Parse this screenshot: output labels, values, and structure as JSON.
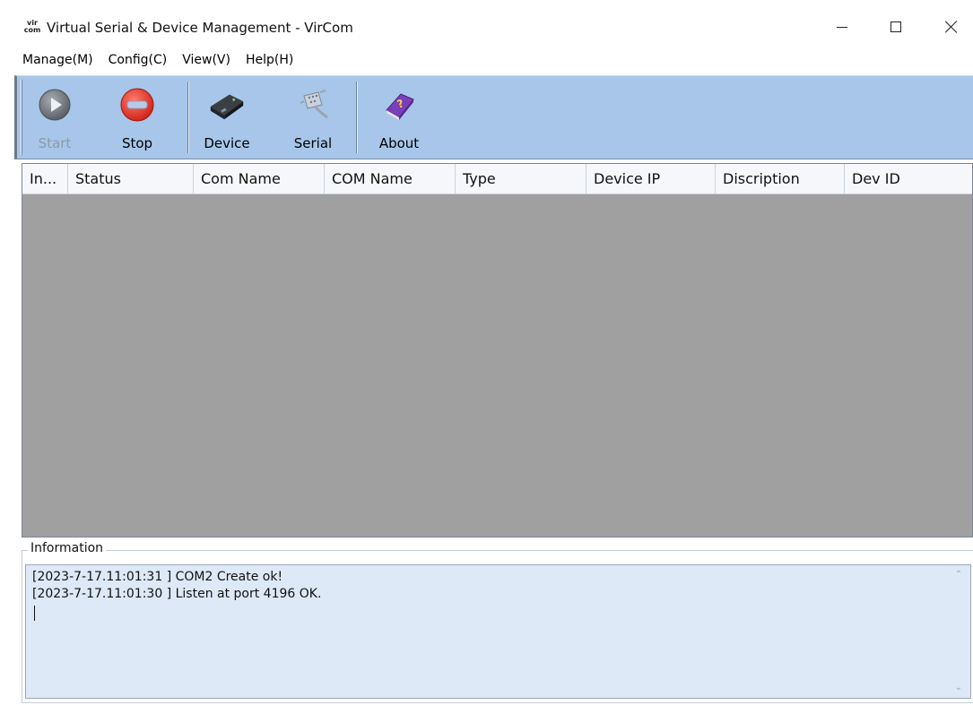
{
  "window": {
    "icon_text_top": "vir",
    "icon_text_bottom": "com",
    "title": "Virtual Serial & Device Management - VirCom"
  },
  "menu": [
    "Manage(M)",
    "Config(C)",
    "View(V)",
    "Help(H)"
  ],
  "toolbar": {
    "start_label": "Start",
    "start_enabled": false,
    "stop_label": "Stop",
    "device_label": "Device",
    "serial_label": "Serial",
    "about_label": "About",
    "icons": {
      "start": "play-icon",
      "stop": "stop-icon",
      "device": "device-icon",
      "serial": "serial-port-icon",
      "about": "book-question-icon"
    }
  },
  "table": {
    "columns": [
      "In...",
      "Status",
      "Com Name",
      "COM Name",
      "Type",
      "Device IP",
      "Discription",
      "Dev ID"
    ],
    "rows": []
  },
  "info": {
    "label": "Information",
    "log_lines": [
      "[2023-7-17.11:01:31 ] COM2 Create ok!",
      "[2023-7-17.11:01:30 ] Listen at port 4196 OK."
    ]
  },
  "colors": {
    "toolbar_bg": "#a7c6ea",
    "list_bg": "#a0a0a0",
    "log_bg": "#dde9f6",
    "stop_red": "#e53b2e"
  }
}
